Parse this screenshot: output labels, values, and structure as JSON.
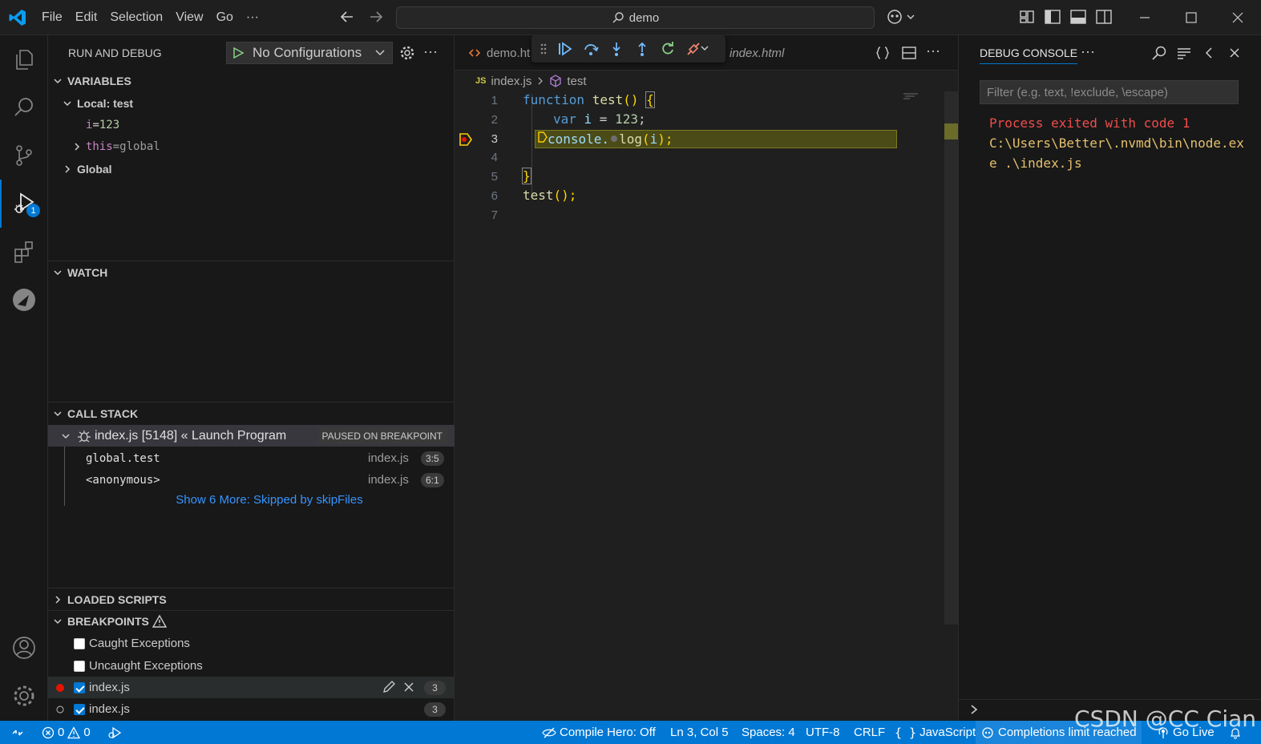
{
  "menu": {
    "items": [
      "File",
      "Edit",
      "Selection",
      "View",
      "Go"
    ],
    "more": "···"
  },
  "command_center": {
    "text": "demo"
  },
  "activity": {
    "debug_badge": "1"
  },
  "sidebar": {
    "title": "RUN AND DEBUG",
    "config_label": "No Configurations",
    "more": "···",
    "variables": {
      "header": "VARIABLES",
      "local_header": "Local: test",
      "items": [
        {
          "name": "i",
          "eq": " = ",
          "value": "123"
        },
        {
          "name": "this",
          "eq": " = ",
          "value": "global"
        }
      ],
      "global_header": "Global"
    },
    "watch": {
      "header": "WATCH"
    },
    "call_stack": {
      "header": "CALL STACK",
      "thread": "index.js [5148] « Launch Program",
      "thread_status": "PAUSED ON BREAKPOINT",
      "frames": [
        {
          "name": "global.test",
          "file": "index.js",
          "pos": "3:5"
        },
        {
          "name": "<anonymous>",
          "file": "index.js",
          "pos": "6:1"
        }
      ],
      "show_more": "Show 6 More: Skipped by skipFiles"
    },
    "loaded_scripts": {
      "header": "LOADED SCRIPTS"
    },
    "breakpoints": {
      "header": "BREAKPOINTS",
      "items": [
        {
          "label": "Caught Exceptions",
          "checked": false
        },
        {
          "label": "Uncaught Exceptions",
          "checked": false
        },
        {
          "label": "index.js",
          "checked": true,
          "count": "3"
        },
        {
          "label": "index.js",
          "checked": true,
          "count": "3"
        }
      ]
    }
  },
  "editor": {
    "tabs": [
      {
        "label": "demo.ht"
      },
      {
        "label": "index.html"
      }
    ],
    "breadcrumb": {
      "lang": "JS",
      "file": "index.js",
      "symbol": "test"
    },
    "line_numbers": [
      "1",
      "2",
      "3",
      "4",
      "5",
      "6",
      "7"
    ],
    "code": {
      "l1_kw": "function",
      "l1_fn": " test",
      "l1_p": "() ",
      "l1_br": "{",
      "l2_kw": "var",
      "l2_v": " i",
      "l2_eq": " = ",
      "l2_n": "123",
      "l2_end": ";",
      "l3_obj": "console.",
      "l3_fn": "log",
      "l3_p1": "(",
      "l3_arg": "i",
      "l3_p2": ");",
      "l5_br": "}",
      "l6_fn": "test",
      "l6_rest": "();"
    }
  },
  "debug_console": {
    "title": "DEBUG CONSOLE",
    "more": "···",
    "filter_placeholder": "Filter (e.g. text, !exclude, \\escape)",
    "lines": [
      "Process exited with code 1",
      "C:\\Users\\Better\\.nvmd\\bin\\node.ex",
      "e .\\index.js"
    ]
  },
  "status": {
    "errors": "0",
    "warnings": "0",
    "compile_hero": "Compile Hero: Off",
    "position": "Ln 3, Col 5",
    "spaces": "Spaces: 4",
    "encoding": "UTF-8",
    "eol": "CRLF",
    "language": "JavaScript",
    "completions": "Completions limit reached",
    "go_live": "Go Live"
  },
  "watermark": "CSDN @CC Cian",
  "colors": {
    "accent": "#0078d4",
    "error_text": "#f14c4c",
    "path_text": "#e5c06d",
    "breakpoint": "#e51400"
  }
}
